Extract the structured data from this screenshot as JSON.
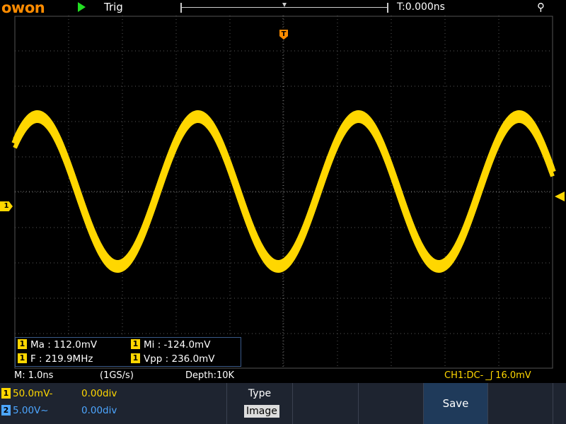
{
  "top": {
    "logo": "owon",
    "trigger_state": "Trig",
    "trigger_time": "T:0.000ns",
    "usb_icon": "usb-icon"
  },
  "screen": {
    "trigger_marker": "T",
    "channel_marker": "1",
    "measurements": [
      {
        "channel": "1",
        "label": "Ma : 112.0mV"
      },
      {
        "channel": "1",
        "label": "Mi : -124.0mV"
      },
      {
        "channel": "1",
        "label": "F : 219.9MHz"
      },
      {
        "channel": "1",
        "label": "Vpp : 236.0mV"
      }
    ],
    "waveform_color": "#ffd700"
  },
  "status": {
    "timebase": "M: 1.0ns",
    "sample_rate": "(1GS/s)",
    "depth": "Depth:10K",
    "trigger_info": "CH1:DC-",
    "trigger_level": "16.0mV",
    "trigger_color": "#ffd700"
  },
  "channels": [
    {
      "num": "1",
      "scale": "50.0mV",
      "coupling": "-",
      "offset": "0.00div",
      "color": "#ffd700"
    },
    {
      "num": "2",
      "scale": "5.00V",
      "coupling": "~",
      "offset": "0.00div",
      "color": "#4da6ff"
    }
  ],
  "menu": {
    "type_title": "Type",
    "type_value": "Image",
    "save_label": "Save"
  }
}
